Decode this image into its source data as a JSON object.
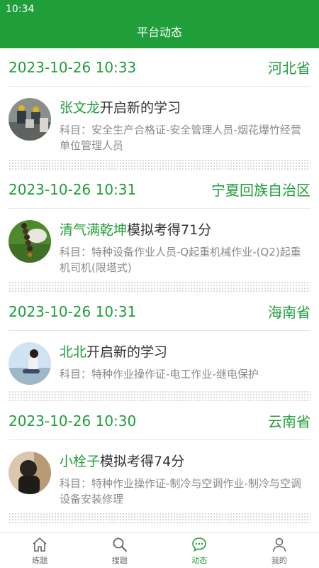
{
  "status_bar": {
    "time": "10:34"
  },
  "header": {
    "title": "平台动态"
  },
  "feed": [
    {
      "time": "2023-10-26 10:33",
      "region": "河北省",
      "user": "张文龙",
      "action": "开启新的学习",
      "subject": "科目：安全生产合格证-安全管理人员-烟花爆竹经营单位管理人员",
      "avatar_icon": "avatar-group-photo-icon"
    },
    {
      "time": "2023-10-26 10:31",
      "region": "宁夏回族自治区",
      "user": "清气满乾坤",
      "action": "模拟考得71分",
      "subject": "科目：特种设备作业人员-Q起重机械作业-(Q2)起重机司机(限塔式)",
      "avatar_icon": "avatar-beads-photo-icon"
    },
    {
      "time": "2023-10-26 10:31",
      "region": "海南省",
      "user": "北北",
      "action": "开启新的学习",
      "subject": "科目：特种作业操作证-电工作业-继电保护",
      "avatar_icon": "avatar-seaside-photo-icon"
    },
    {
      "time": "2023-10-26 10:30",
      "region": "云南省",
      "user": "小栓子",
      "action": "模拟考得74分",
      "subject": "科目：特种作业操作证-制冷与空调作业-制冷与空调设备安装修理",
      "avatar_icon": "avatar-portrait-photo-icon"
    }
  ],
  "tabs": [
    {
      "label": "练题",
      "icon": "home-icon"
    },
    {
      "label": "搜题",
      "icon": "search-icon"
    },
    {
      "label": "动态",
      "icon": "chat-icon",
      "active": true
    },
    {
      "label": "我的",
      "icon": "user-icon"
    }
  ],
  "colors": {
    "primary": "#1f9e3a",
    "muted_text": "#8a8a8a",
    "body_text": "#333333"
  }
}
